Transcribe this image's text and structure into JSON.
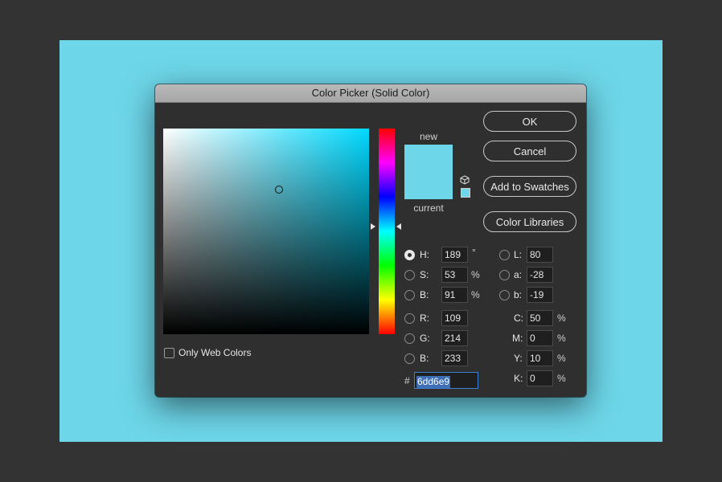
{
  "colors": {
    "background": "#333333",
    "canvas": "#6dd6e9",
    "new_swatch": "#6dd6e9",
    "current_swatch": "#6dd6e9",
    "field_hue": "#00d9ff"
  },
  "dialog": {
    "title": "Color Picker (Solid Color)"
  },
  "preview": {
    "new_label": "new",
    "current_label": "current"
  },
  "buttons": {
    "ok": "OK",
    "cancel": "Cancel",
    "add_to_swatches": "Add to Swatches",
    "color_libraries": "Color Libraries"
  },
  "hsb": {
    "h": {
      "label": "H:",
      "value": "189",
      "unit": "°",
      "selected": true
    },
    "s": {
      "label": "S:",
      "value": "53",
      "unit": "%"
    },
    "b": {
      "label": "B:",
      "value": "91",
      "unit": "%"
    }
  },
  "rgb": {
    "r": {
      "label": "R:",
      "value": "109"
    },
    "g": {
      "label": "G:",
      "value": "214"
    },
    "b": {
      "label": "B:",
      "value": "233"
    }
  },
  "lab": {
    "l": {
      "label": "L:",
      "value": "80"
    },
    "a": {
      "label": "a:",
      "value": "-28"
    },
    "b": {
      "label": "b:",
      "value": "-19"
    }
  },
  "cmyk": {
    "c": {
      "label": "C:",
      "value": "50",
      "unit": "%"
    },
    "m": {
      "label": "M:",
      "value": "0",
      "unit": "%"
    },
    "y": {
      "label": "Y:",
      "value": "10",
      "unit": "%"
    },
    "k": {
      "label": "K:",
      "value": "0",
      "unit": "%"
    }
  },
  "hex": {
    "prefix": "#",
    "value": "6dd6e9"
  },
  "only_web_colors": {
    "label": "Only Web Colors",
    "checked": false
  }
}
